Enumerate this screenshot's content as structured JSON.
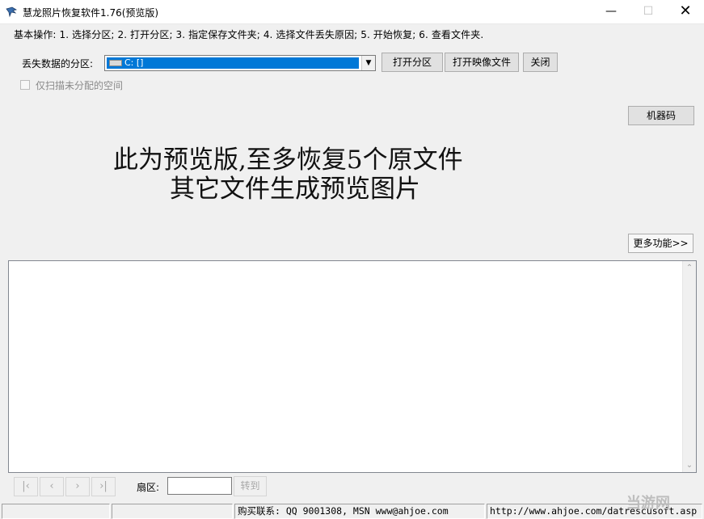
{
  "window": {
    "title": "慧龙照片恢复软件1.76(预览版)",
    "minimize_glyph": "—",
    "maximize_glyph": "☐",
    "close_glyph": "✕",
    "icon": "app-icon"
  },
  "steps_text": "基本操作: 1. 选择分区; 2. 打开分区; 3. 指定保存文件夹; 4. 选择文件丢失原因; 5. 开始恢复; 6. 查看文件夹.",
  "partition": {
    "label": "丢失数据的分区:",
    "selected_value": "C:  []",
    "arrow_glyph": "▼",
    "icon": "drive-icon"
  },
  "buttons": {
    "open_partition": "打开分区",
    "open_image": "打开映像文件",
    "close": "关闭",
    "machine_code": "机器码",
    "more_functions": "更多功能>>"
  },
  "unallocated_checkbox": {
    "label": "仅扫描未分配的空间",
    "checked": false
  },
  "notice": {
    "line1": "此为预览版,至多恢复5个原文件",
    "line2": "其它文件生成预览图片"
  },
  "scrollbar": {
    "up_glyph": "⌃",
    "down_glyph": "⌄"
  },
  "navigation": {
    "first": "|‹",
    "prev": "‹",
    "next": "›",
    "last": "›|"
  },
  "sector": {
    "label": "扇区:",
    "value": "",
    "goto_label": "转到"
  },
  "statusbar": {
    "cell1": "",
    "cell2": "",
    "cell3": "购买联系: QQ 9001308, MSN www@ahjoe.com",
    "cell4": "http://www.ahjoe.com/datrescusoft.asp"
  },
  "watermark": "当游网"
}
